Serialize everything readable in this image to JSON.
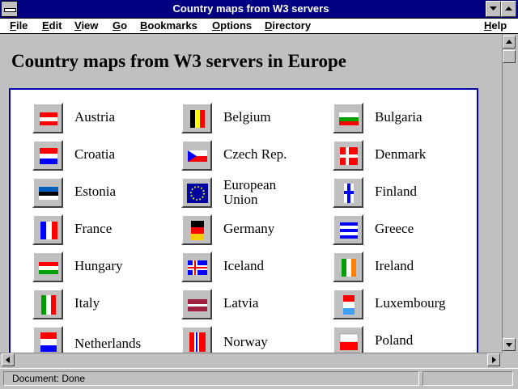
{
  "window": {
    "title": "Country maps from W3 servers"
  },
  "menu": [
    "File",
    "Edit",
    "View",
    "Go",
    "Bookmarks",
    "Options",
    "Directory",
    "Help"
  ],
  "page": {
    "heading": "Country maps from W3 servers in Europe"
  },
  "countries": [
    {
      "name": "Austria",
      "colors": [
        "#ff0000",
        "#ffffff",
        "#ff0000"
      ]
    },
    {
      "name": "Belgium",
      "colors": [
        "#000000",
        "#ffff00",
        "#ff0000"
      ]
    },
    {
      "name": "Bulgaria",
      "colors": [
        "#ffffff",
        "#00a000",
        "#ff0000"
      ]
    },
    {
      "name": "Croatia",
      "colors": [
        "#ff0000",
        "#ffffff",
        "#0000ff"
      ]
    },
    {
      "name": "Czech Rep.",
      "colors": [
        "#ffffff",
        "#ff0000",
        "#0000ff"
      ]
    },
    {
      "name": "Denmark",
      "colors": [
        "#ff0000",
        "#ffffff",
        "#ff0000"
      ]
    },
    {
      "name": "Estonia",
      "colors": [
        "#0060c0",
        "#000000",
        "#ffffff"
      ]
    },
    {
      "name": "European Union",
      "colors": [
        "#0000a0",
        "#ffff00",
        "#0000a0"
      ]
    },
    {
      "name": "Finland",
      "colors": [
        "#ffffff",
        "#0000ff",
        "#ffffff"
      ]
    },
    {
      "name": "France",
      "colors": [
        "#0000ff",
        "#ffffff",
        "#ff0000"
      ]
    },
    {
      "name": "Germany",
      "colors": [
        "#000000",
        "#ff0000",
        "#ffcc00"
      ]
    },
    {
      "name": "Greece",
      "colors": [
        "#0000ff",
        "#ffffff",
        "#0000ff"
      ]
    },
    {
      "name": "Hungary",
      "colors": [
        "#ff0000",
        "#ffffff",
        "#00a000"
      ]
    },
    {
      "name": "Iceland",
      "colors": [
        "#0000ff",
        "#ff0000",
        "#ffffff"
      ]
    },
    {
      "name": "Ireland",
      "colors": [
        "#00a000",
        "#ffffff",
        "#ff8000"
      ]
    },
    {
      "name": "Italy",
      "colors": [
        "#00a000",
        "#ffffff",
        "#ff0000"
      ]
    },
    {
      "name": "Latvia",
      "colors": [
        "#a02040",
        "#ffffff",
        "#a02040"
      ]
    },
    {
      "name": "Luxembourg",
      "colors": [
        "#ff0000",
        "#ffffff",
        "#40a0ff"
      ]
    },
    {
      "name": "Netherlands",
      "colors": [
        "#ff0000",
        "#ffffff",
        "#0000ff"
      ]
    },
    {
      "name": "Norway",
      "colors": [
        "#ff0000",
        "#ffffff",
        "#0000ff"
      ]
    },
    {
      "name": "Poland",
      "colors": [
        "#ffffff",
        "#ffffff",
        "#ff0000"
      ]
    }
  ],
  "status": {
    "text": "Document: Done"
  }
}
